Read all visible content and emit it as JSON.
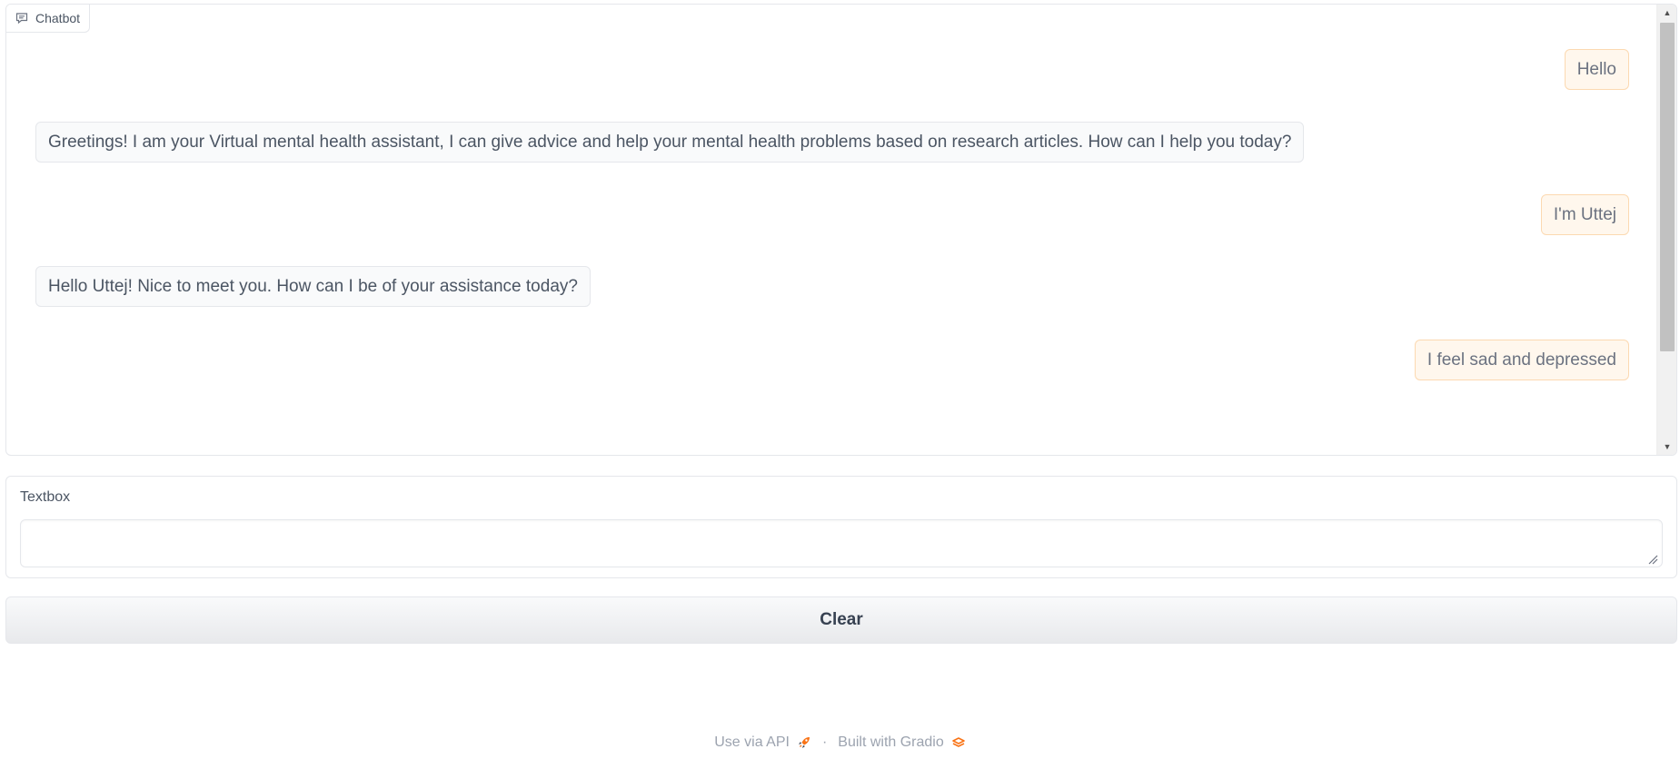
{
  "chatbot": {
    "label": "Chatbot",
    "label_icon": "chat-icon",
    "messages": [
      {
        "role": "user",
        "text": "Hello"
      },
      {
        "role": "bot",
        "text": "Greetings! I am your Virtual mental health assistant, I can give advice and help your mental health problems based on research articles. How can I help you today?"
      },
      {
        "role": "user",
        "text": "I'm Uttej"
      },
      {
        "role": "bot",
        "text": "Hello Uttej! Nice to meet you. How can I be of your assistance today?"
      },
      {
        "role": "user",
        "text": "I feel sad and depressed"
      }
    ]
  },
  "textbox": {
    "label": "Textbox",
    "value": "",
    "placeholder": ""
  },
  "clear_button": {
    "label": "Clear"
  },
  "footer": {
    "api_link": "Use via API",
    "api_icon": "rocket-icon",
    "separator": "·",
    "built_with": "Built with Gradio",
    "gradio_icon": "gradio-logo-icon"
  },
  "colors": {
    "user_bubble_bg": "#fff7ed",
    "user_bubble_border": "#fcd9b1",
    "bot_bubble_bg": "#f9fafb",
    "accent": "#f97316"
  }
}
